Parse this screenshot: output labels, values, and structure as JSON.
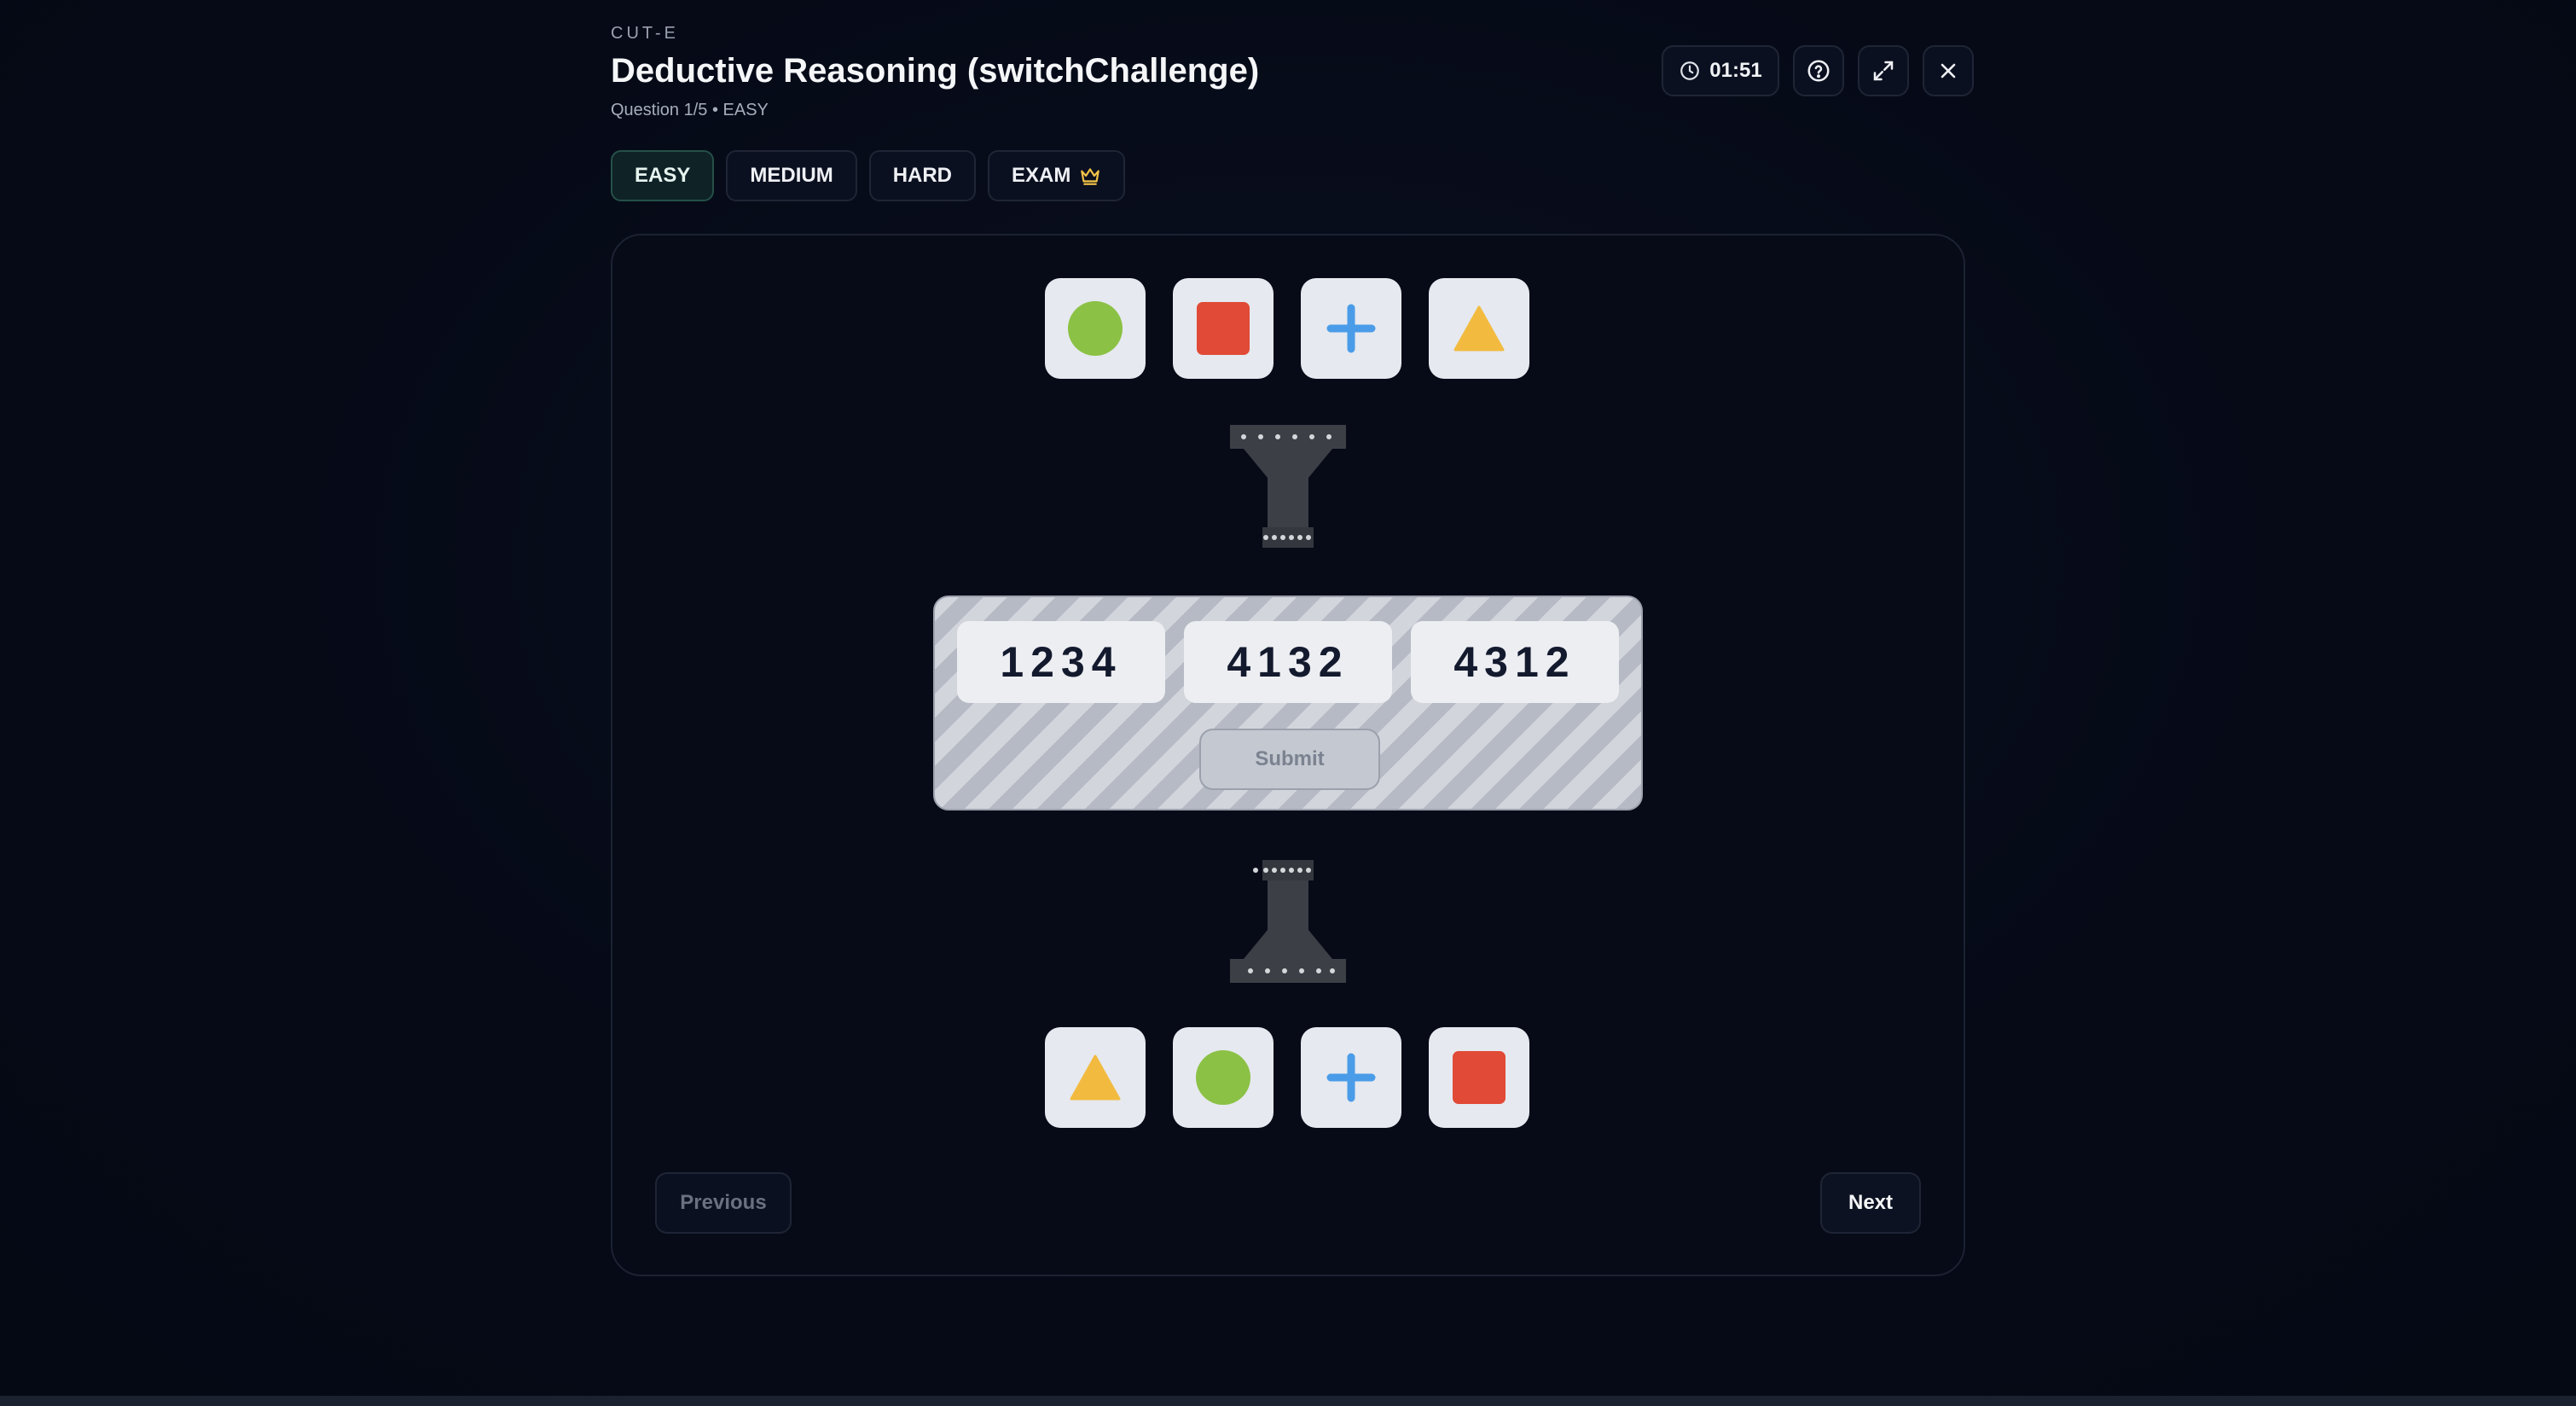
{
  "header": {
    "brand": "CUT-E",
    "title": "Deductive Reasoning (switchChallenge)",
    "subtitle": "Question 1/5 • EASY"
  },
  "toolbar": {
    "timer": "01:51",
    "icons": [
      "clock-icon",
      "help-icon",
      "expand-icon",
      "close-icon"
    ]
  },
  "tabs": [
    {
      "label": "EASY",
      "active": true
    },
    {
      "label": "MEDIUM",
      "active": false
    },
    {
      "label": "HARD",
      "active": false
    },
    {
      "label": "EXAM",
      "active": false,
      "icon": "crown-icon"
    }
  ],
  "puzzle": {
    "input_shapes": [
      "circle",
      "square",
      "plus",
      "triangle"
    ],
    "output_shapes": [
      "triangle",
      "circle",
      "plus",
      "square"
    ],
    "shape_colors": {
      "circle": "#8bc145",
      "square": "#e14a36",
      "plus": "#4a9ce8",
      "triangle": "#f2bb40"
    },
    "options": [
      "1234",
      "4132",
      "4312"
    ],
    "submit_label": "Submit"
  },
  "nav": {
    "previous_label": "Previous",
    "next_label": "Next"
  }
}
